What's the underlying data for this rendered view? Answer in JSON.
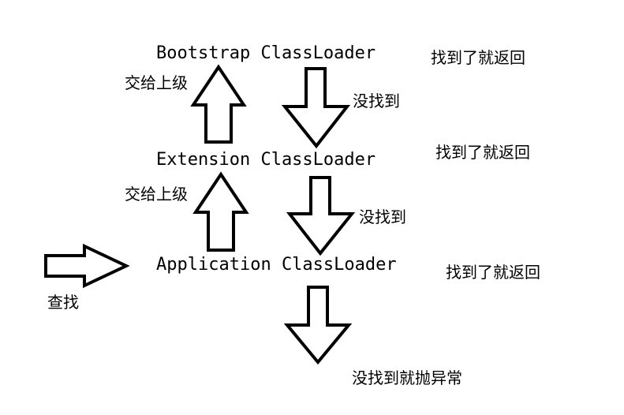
{
  "loaders": {
    "bootstrap": "Bootstrap ClassLoader",
    "extension": "Extension ClassLoader",
    "application": "Application ClassLoader"
  },
  "labels": {
    "found_return": "找到了就返回",
    "not_found": "没找到",
    "delegate_up": "交给上级",
    "lookup": "查找",
    "not_found_throw": "没找到就抛异常"
  },
  "colors": {
    "stroke": "#000000",
    "fill": "#ffffff"
  }
}
